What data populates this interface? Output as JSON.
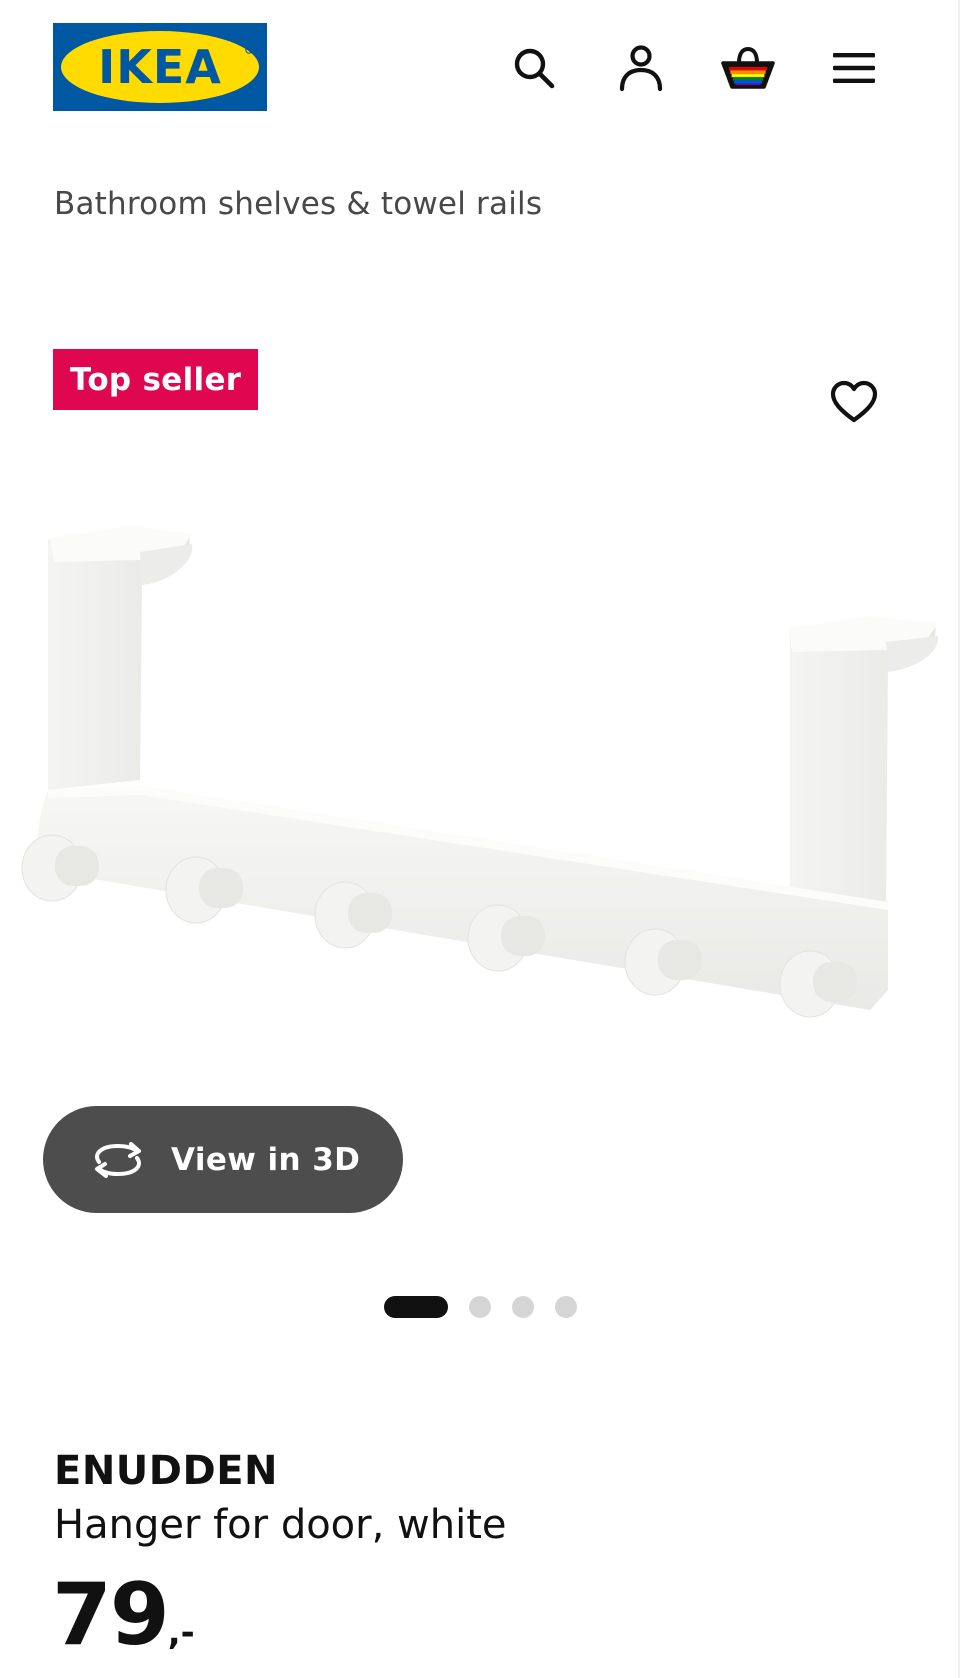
{
  "header": {
    "logo_text": "IKEA",
    "icons": [
      "search-icon",
      "user-icon",
      "basket-icon",
      "menu-icon"
    ]
  },
  "breadcrumb": "Bathroom shelves & towel rails",
  "badge": "Top seller",
  "view3d": {
    "label": "View in 3D"
  },
  "pager": {
    "count": 4,
    "active_index": 0
  },
  "product": {
    "name": "ENUDDEN",
    "description": "Hanger for door, white",
    "price": "79",
    "price_suffix": ",-"
  },
  "colors": {
    "ikea_blue": "#0058a3",
    "ikea_yellow": "#ffdb00",
    "badge_red": "#e00751",
    "button_gray": "#4d4d4d"
  }
}
